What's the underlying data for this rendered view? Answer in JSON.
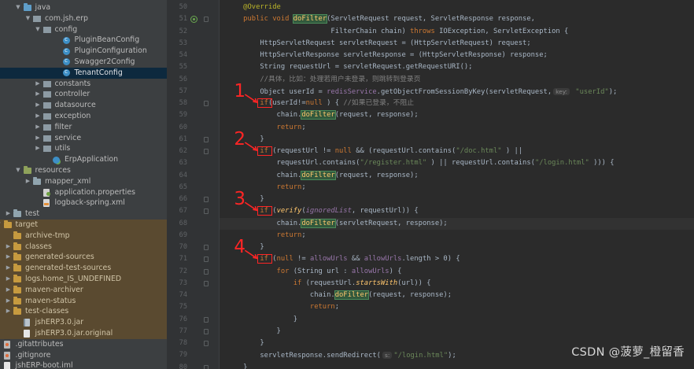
{
  "project_tree": [
    {
      "label": "java",
      "kind": "folder-blue",
      "depth": 1,
      "arrow": "open"
    },
    {
      "label": "com.jsh.erp",
      "kind": "pkg",
      "depth": 2,
      "arrow": "open"
    },
    {
      "label": "config",
      "kind": "pkg",
      "depth": 3,
      "arrow": "open"
    },
    {
      "label": "PluginBeanConfig",
      "kind": "class",
      "depth": 5,
      "arrow": ""
    },
    {
      "label": "PluginConfiguration",
      "kind": "class",
      "depth": 5,
      "arrow": ""
    },
    {
      "label": "Swagger2Config",
      "kind": "class",
      "depth": 5,
      "arrow": ""
    },
    {
      "label": "TenantConfig",
      "kind": "class",
      "depth": 5,
      "arrow": "",
      "selected": true
    },
    {
      "label": "constants",
      "kind": "pkg",
      "depth": 3,
      "arrow": "closed"
    },
    {
      "label": "controller",
      "kind": "pkg",
      "depth": 3,
      "arrow": "closed"
    },
    {
      "label": "datasource",
      "kind": "pkg",
      "depth": 3,
      "arrow": "closed"
    },
    {
      "label": "exception",
      "kind": "pkg",
      "depth": 3,
      "arrow": "closed"
    },
    {
      "label": "filter",
      "kind": "pkg",
      "depth": 3,
      "arrow": "closed"
    },
    {
      "label": "service",
      "kind": "pkg",
      "depth": 3,
      "arrow": "closed"
    },
    {
      "label": "utils",
      "kind": "pkg",
      "depth": 3,
      "arrow": "closed"
    },
    {
      "label": "ErpApplication",
      "kind": "spring",
      "depth": 4,
      "arrow": ""
    },
    {
      "label": "resources",
      "kind": "folder-res",
      "depth": 1,
      "arrow": "open"
    },
    {
      "label": "mapper_xml",
      "kind": "folder",
      "depth": 2,
      "arrow": "closed"
    },
    {
      "label": "application.properties",
      "kind": "props",
      "depth": 3,
      "arrow": ""
    },
    {
      "label": "logback-spring.xml",
      "kind": "xml",
      "depth": 3,
      "arrow": ""
    },
    {
      "label": "test",
      "kind": "folder",
      "depth": 0,
      "arrow": "closed"
    },
    {
      "label": "target",
      "kind": "folder-orange",
      "depth": -1,
      "arrow": "open",
      "excluded": true
    },
    {
      "label": "archive-tmp",
      "kind": "folder-orange",
      "depth": 0,
      "arrow": "",
      "excluded": true
    },
    {
      "label": "classes",
      "kind": "folder-orange",
      "depth": 0,
      "arrow": "closed",
      "excluded": true
    },
    {
      "label": "generated-sources",
      "kind": "folder-orange",
      "depth": 0,
      "arrow": "closed",
      "excluded": true
    },
    {
      "label": "generated-test-sources",
      "kind": "folder-orange",
      "depth": 0,
      "arrow": "closed",
      "excluded": true
    },
    {
      "label": "logs.home_IS_UNDEFINED",
      "kind": "folder-orange",
      "depth": 0,
      "arrow": "closed",
      "excluded": true
    },
    {
      "label": "maven-archiver",
      "kind": "folder-orange",
      "depth": 0,
      "arrow": "closed",
      "excluded": true
    },
    {
      "label": "maven-status",
      "kind": "folder-orange",
      "depth": 0,
      "arrow": "closed",
      "excluded": true
    },
    {
      "label": "test-classes",
      "kind": "folder-orange",
      "depth": 0,
      "arrow": "closed",
      "excluded": true
    },
    {
      "label": "jshERP3.0.jar",
      "kind": "jar",
      "depth": 1,
      "arrow": "",
      "excluded": true
    },
    {
      "label": "jshERP3.0.jar.original",
      "kind": "file",
      "depth": 1,
      "arrow": "",
      "excluded": true
    },
    {
      "label": ".gitattributes",
      "kind": "git",
      "depth": -1,
      "arrow": ""
    },
    {
      "label": ".gitignore",
      "kind": "git",
      "depth": -1,
      "arrow": ""
    },
    {
      "label": "jshERP-boot.iml",
      "kind": "file",
      "depth": -1,
      "arrow": ""
    }
  ],
  "editor": {
    "current_line": 68,
    "lines": [
      {
        "n": 50,
        "fold": false,
        "tokens": [
          [
            "ann",
            "    @Override"
          ]
        ]
      },
      {
        "n": 51,
        "fold": true,
        "override": true,
        "tokens": [
          [
            "kw",
            "    public void "
          ],
          [
            "hl",
            "doFilter"
          ],
          [
            "",
            "(ServletRequest request, ServletResponse response,"
          ]
        ]
      },
      {
        "n": 52,
        "fold": false,
        "tokens": [
          [
            "",
            "                         FilterChain chain) "
          ],
          [
            "kw",
            "throws "
          ],
          [
            "",
            "IOException, ServletException {"
          ]
        ]
      },
      {
        "n": 53,
        "fold": false,
        "tokens": [
          [
            "",
            "        HttpServletRequest servletRequest = (HttpServletRequest) request;"
          ]
        ]
      },
      {
        "n": 54,
        "fold": false,
        "tokens": [
          [
            "",
            "        HttpServletResponse servletResponse = (HttpServletResponse) response;"
          ]
        ]
      },
      {
        "n": 55,
        "fold": false,
        "tokens": [
          [
            "",
            "        String requestUrl = servletRequest.getRequestURI();"
          ]
        ]
      },
      {
        "n": 56,
        "fold": false,
        "tokens": [
          [
            "cmt",
            "        //具体，比如：处理若用户未登录，则跳转到登录页"
          ]
        ]
      },
      {
        "n": 57,
        "fold": false,
        "tokens": [
          [
            "",
            "        Object userId = "
          ],
          [
            "fld",
            "redisService"
          ],
          [
            "",
            ".getObjectFromSessionByKey(servletRequest,"
          ],
          [
            "hint",
            "key:"
          ],
          [
            "str",
            " \"userId\""
          ],
          [
            "",
            ");"
          ]
        ]
      },
      {
        "n": 58,
        "fold": true,
        "tokens": [
          [
            "kw",
            "        if"
          ],
          [
            "",
            "(userId!="
          ],
          [
            "kw",
            "null"
          ],
          [
            "",
            " ) { "
          ],
          [
            "cmt",
            "//如果已登录，不阻止"
          ]
        ]
      },
      {
        "n": 59,
        "fold": false,
        "tokens": [
          [
            "",
            "            chain."
          ],
          [
            "hl",
            "doFilter"
          ],
          [
            "",
            "(request, response);"
          ]
        ]
      },
      {
        "n": 60,
        "fold": false,
        "tokens": [
          [
            "kw",
            "            return"
          ],
          [
            "",
            ";"
          ]
        ]
      },
      {
        "n": 61,
        "fold": true,
        "tokens": [
          [
            "",
            "        }"
          ]
        ]
      },
      {
        "n": 62,
        "fold": true,
        "tokens": [
          [
            "kw",
            "        if "
          ],
          [
            "",
            "(requestUrl != "
          ],
          [
            "kw",
            "null "
          ],
          [
            "",
            "&& (requestUrl.contains("
          ],
          [
            "str",
            "\"/doc.html\""
          ],
          [
            "",
            " ) ||"
          ]
        ]
      },
      {
        "n": 63,
        "fold": false,
        "tokens": [
          [
            "",
            "            requestUrl.contains("
          ],
          [
            "str",
            "\"/register.html\""
          ],
          [
            "",
            " ) || requestUrl.contains("
          ],
          [
            "str",
            "\"/login.html\""
          ],
          [
            "",
            " ))) {"
          ]
        ]
      },
      {
        "n": 64,
        "fold": false,
        "tokens": [
          [
            "",
            "            chain."
          ],
          [
            "hl",
            "doFilter"
          ],
          [
            "",
            "(request, response);"
          ]
        ]
      },
      {
        "n": 65,
        "fold": false,
        "tokens": [
          [
            "kw",
            "            return"
          ],
          [
            "",
            ";"
          ]
        ]
      },
      {
        "n": 66,
        "fold": true,
        "tokens": [
          [
            "",
            "        }"
          ]
        ]
      },
      {
        "n": 67,
        "fold": true,
        "tokens": [
          [
            "kw",
            "        if "
          ],
          [
            "",
            "("
          ],
          [
            "it fn",
            "verify"
          ],
          [
            "",
            "("
          ],
          [
            "it fld",
            "ignoredList"
          ],
          [
            "",
            ", requestUrl)) {"
          ]
        ]
      },
      {
        "n": 68,
        "fold": false,
        "tokens": [
          [
            "",
            "            chain."
          ],
          [
            "hl",
            "doFilter"
          ],
          [
            "",
            "(servletRequest, response);"
          ]
        ]
      },
      {
        "n": 69,
        "fold": false,
        "tokens": [
          [
            "kw",
            "            return"
          ],
          [
            "",
            ";"
          ]
        ]
      },
      {
        "n": 70,
        "fold": true,
        "tokens": [
          [
            "",
            "        }"
          ]
        ]
      },
      {
        "n": 71,
        "fold": true,
        "tokens": [
          [
            "kw",
            "        if "
          ],
          [
            "",
            "("
          ],
          [
            "kw",
            "null "
          ],
          [
            "",
            "!= "
          ],
          [
            "fld",
            "allowUrls "
          ],
          [
            "",
            "&& "
          ],
          [
            "fld",
            "allowUrls"
          ],
          [
            "",
            ".length > 0) {"
          ]
        ]
      },
      {
        "n": 72,
        "fold": true,
        "tokens": [
          [
            "kw",
            "            for "
          ],
          [
            "",
            "(String url : "
          ],
          [
            "fld",
            "allowUrls"
          ],
          [
            "",
            ") {"
          ]
        ]
      },
      {
        "n": 73,
        "fold": true,
        "tokens": [
          [
            "kw",
            "                if "
          ],
          [
            "",
            "(requestUrl."
          ],
          [
            "it fn",
            "startsWith"
          ],
          [
            "",
            "(url)) {"
          ]
        ]
      },
      {
        "n": 74,
        "fold": false,
        "tokens": [
          [
            "",
            "                    chain."
          ],
          [
            "hl",
            "doFilter"
          ],
          [
            "",
            "(request, response);"
          ]
        ]
      },
      {
        "n": 75,
        "fold": false,
        "tokens": [
          [
            "kw",
            "                    return"
          ],
          [
            "",
            ";"
          ]
        ]
      },
      {
        "n": 76,
        "fold": true,
        "tokens": [
          [
            "",
            "                }"
          ]
        ]
      },
      {
        "n": 77,
        "fold": true,
        "tokens": [
          [
            "",
            "            }"
          ]
        ]
      },
      {
        "n": 78,
        "fold": true,
        "tokens": [
          [
            "",
            "        }"
          ]
        ]
      },
      {
        "n": 79,
        "fold": false,
        "tokens": [
          [
            "",
            "        servletResponse.sendRedirect("
          ],
          [
            "hint",
            "s:"
          ],
          [
            "str",
            "\"/login.html\""
          ],
          [
            "",
            ");"
          ]
        ]
      },
      {
        "n": 80,
        "fold": true,
        "tokens": [
          [
            "",
            "    }"
          ]
        ]
      }
    ]
  },
  "annotations": [
    {
      "number": "1",
      "target_line": 58
    },
    {
      "number": "2",
      "target_line": 62
    },
    {
      "number": "3",
      "target_line": 67
    },
    {
      "number": "4",
      "target_line": 71
    }
  ],
  "colors": {
    "annotation": "#ff2525",
    "keyword": "#cc7832",
    "string": "#6a8759",
    "method_highlight": "#32593d"
  },
  "watermark": "CSDN @菠萝_橙留香"
}
